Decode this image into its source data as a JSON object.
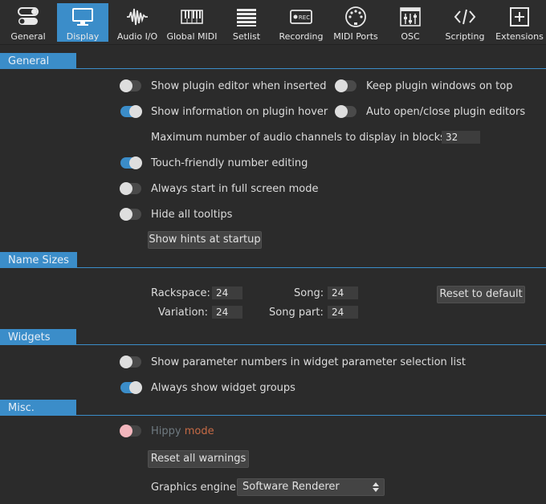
{
  "toolbar": {
    "tabs": [
      {
        "label": "General",
        "icon": "toggles-icon"
      },
      {
        "label": "Display",
        "icon": "monitor-icon",
        "active": true
      },
      {
        "label": "Audio I/O",
        "icon": "waveform-icon"
      },
      {
        "label": "Global MIDI",
        "icon": "keyboard-icon"
      },
      {
        "label": "Setlist",
        "icon": "list-icon"
      },
      {
        "label": "Recording",
        "icon": "rec-icon"
      },
      {
        "label": "MIDI Ports",
        "icon": "midi-port-icon"
      },
      {
        "label": "OSC",
        "icon": "osc-icon"
      },
      {
        "label": "Scripting",
        "icon": "code-icon"
      },
      {
        "label": "Extensions",
        "icon": "plus-box-icon"
      }
    ],
    "accent_color": "#3b8dc9"
  },
  "general": {
    "header": "General",
    "show_plugin_editor": {
      "label": "Show plugin editor when inserted",
      "on": false
    },
    "keep_plugin_windows": {
      "label": "Keep plugin windows on top",
      "on": false
    },
    "show_info_hover": {
      "label": "Show information on plugin hover",
      "on": true
    },
    "auto_open_close": {
      "label": "Auto open/close plugin editors",
      "on": false
    },
    "max_channels": {
      "label": "Maximum number of audio channels to display in blocks",
      "value": "32"
    },
    "touch_friendly": {
      "label": "Touch-friendly number editing",
      "on": true
    },
    "full_screen": {
      "label": "Always start in full screen mode",
      "on": false
    },
    "hide_tooltips": {
      "label": "Hide all tooltips",
      "on": false
    },
    "show_hints_button": "Show hints at startup"
  },
  "name_sizes": {
    "header": "Name Sizes",
    "rackspace": {
      "label": "Rackspace:",
      "value": "24"
    },
    "song": {
      "label": "Song:",
      "value": "24"
    },
    "variation": {
      "label": "Variation:",
      "value": "24"
    },
    "song_part": {
      "label": "Song part:",
      "value": "24"
    },
    "reset_button": "Reset to default"
  },
  "widgets": {
    "header": "Widgets",
    "param_numbers": {
      "label": "Show parameter numbers in widget parameter selection list",
      "on": false
    },
    "widget_groups": {
      "label": "Always show widget groups",
      "on": true
    }
  },
  "misc": {
    "header": "Misc.",
    "hippy_a": "Hippy",
    "hippy_b": "mode",
    "reset_warnings_button": "Reset all warnings",
    "graphics_engine": {
      "label": "Graphics engine",
      "value": "Software Renderer"
    }
  }
}
